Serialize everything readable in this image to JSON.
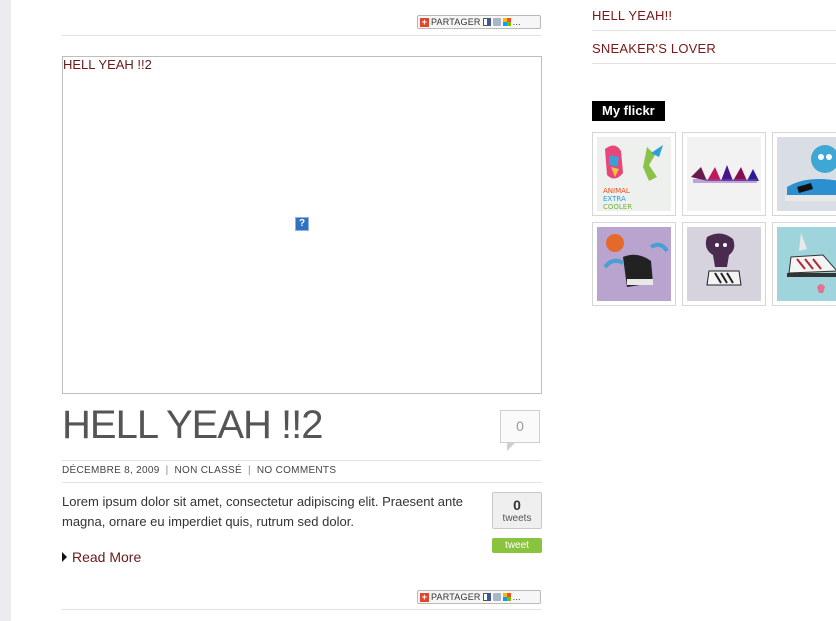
{
  "share": {
    "label": "PARTAGER",
    "more": "..."
  },
  "post": {
    "image_alt": "HELL YEAH !!2",
    "broken_icon": "?",
    "title": "HELL YEAH !!2",
    "comment_count": "0",
    "date": "DÉCEMBRE 8, 2009",
    "category": "NON CLASSÉ",
    "comments_label": "NO COMMENTS",
    "separator": "|",
    "excerpt": "Lorem ipsum dolor sit amet, consectetur adipiscing elit. Praesent ante magna, ornare eu imperdiet quis, rutrum sed dolor.",
    "read_more": "Read More"
  },
  "tweet": {
    "count": "0",
    "label": "tweets",
    "button": "tweet"
  },
  "sidebar": {
    "links": [
      "HELL YEAH!!",
      "SNEAKER'S LOVER"
    ],
    "flickr_title": "My flickr"
  },
  "colors": {
    "link": "#7a1818",
    "tweet_green": "#8ac43f"
  }
}
